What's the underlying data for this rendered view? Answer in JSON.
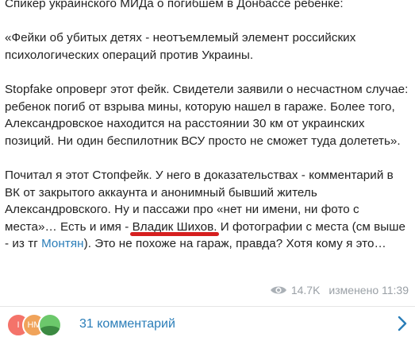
{
  "post": {
    "para1": "Спикер украинского МИДа о погибшем в Донбассе ребенке:",
    "para2": "«Фейки об убитых детях - неотъемлемый элемент российских психологических операций против Украины.",
    "para3": "Stopfake опроверг этот фейк. Свидетели заявили о несчастном случае: ребенок погиб от взрыва мины, которую нашел в гараже. Более того, Александровское находится на расстоянии 30 км от украинских позиций. Ни один беспилотник ВСУ просто не сможет туда долететь».",
    "para4_part1": "Почитал я этот Стопфейк. У него в доказательствах - комментарий в ВК от закрытого аккаунта и анонимный бывший житель Александровского. Ну и пассажи про «нет ни имени, ни фото с места»… Есть и имя - ",
    "para4_name": "Владик Шихов.",
    "para4_part2": " И фотографии с места (см выше - из тг ",
    "para4_link": "Монтян",
    "para4_part3": "). Это не похоже на гараж, правда? Хотя кому я это…"
  },
  "meta": {
    "views": "14.7K",
    "edited": "изменено 11:39"
  },
  "footer": {
    "avatar1": "I",
    "avatar2": "НМ",
    "comments": "31 комментарий"
  },
  "colors": {
    "link": "#2a7db8",
    "underline": "#d61f1f"
  }
}
